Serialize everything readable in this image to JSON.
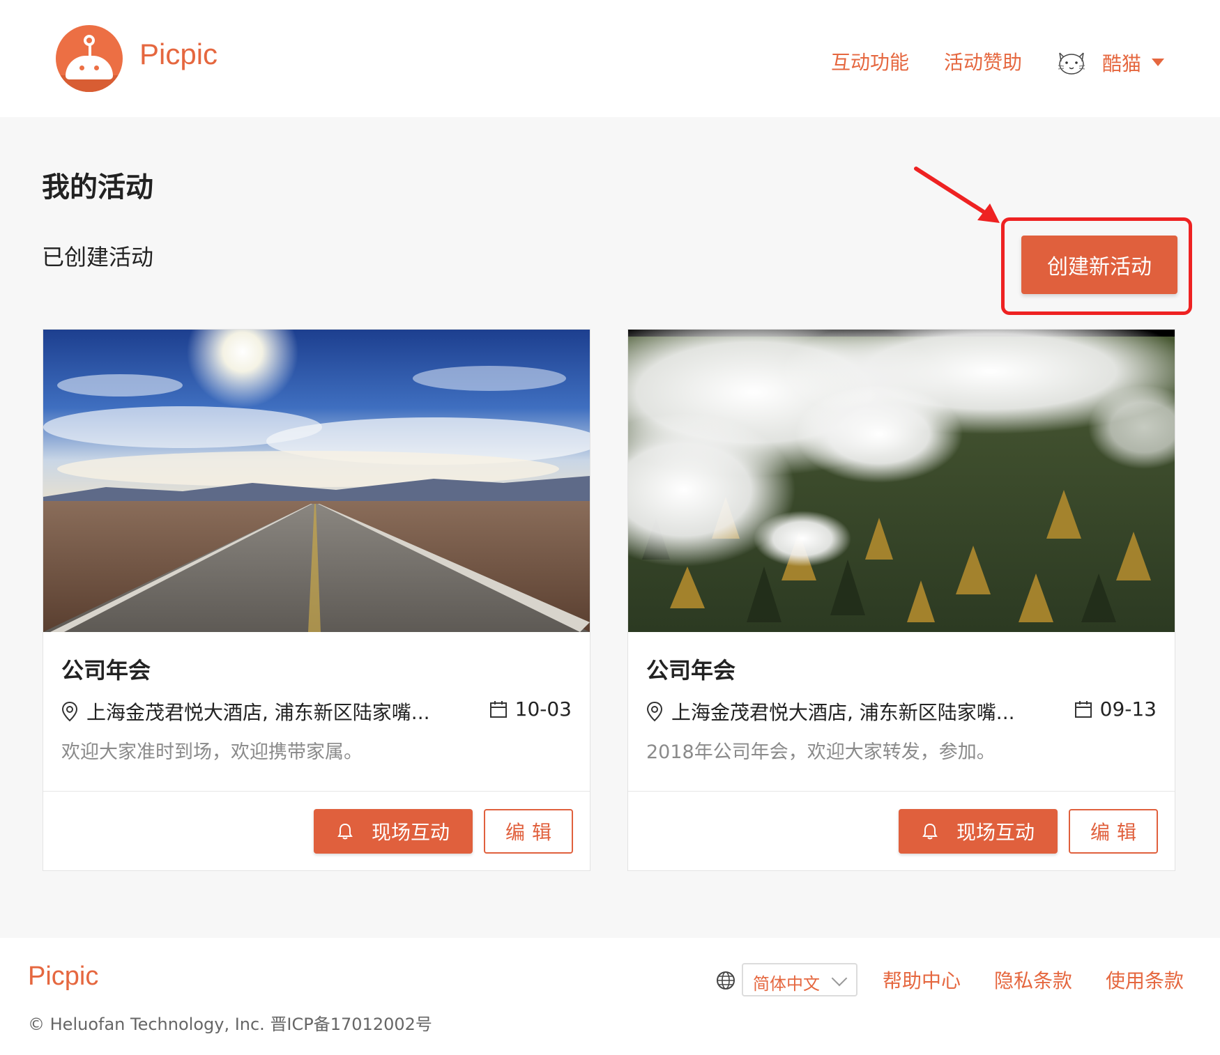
{
  "header": {
    "brand": "Picpic",
    "nav": [
      "互动功能",
      "活动赞助"
    ],
    "user_name": "酷猫"
  },
  "page": {
    "title": "我的活动",
    "section_title": "已创建活动",
    "create_button": "创建新活动"
  },
  "cards": [
    {
      "title": "公司年会",
      "location": "上海金茂君悦大酒店, 浦东新区陆家嘴...",
      "date": "10-03",
      "description": "欢迎大家准时到场，欢迎携带家属。",
      "live_button": "现场互动",
      "edit_button": "编辑",
      "image_icon": "desert-road-photo"
    },
    {
      "title": "公司年会",
      "location": "上海金茂君悦大酒店, 浦东新区陆家嘴...",
      "date": "09-13",
      "description": "2018年公司年会，欢迎大家转发，参加。",
      "live_button": "现场互动",
      "edit_button": "编辑",
      "image_icon": "misty-forest-photo"
    }
  ],
  "footer": {
    "brand": "Picpic",
    "language": "简体中文",
    "links": [
      "帮助中心",
      "隐私条款",
      "使用条款"
    ],
    "copyright": "© Heluofan Technology, Inc. 晋ICP备17012002号"
  },
  "colors": {
    "accent": "#e0603d",
    "annotation": "#ee2222"
  }
}
